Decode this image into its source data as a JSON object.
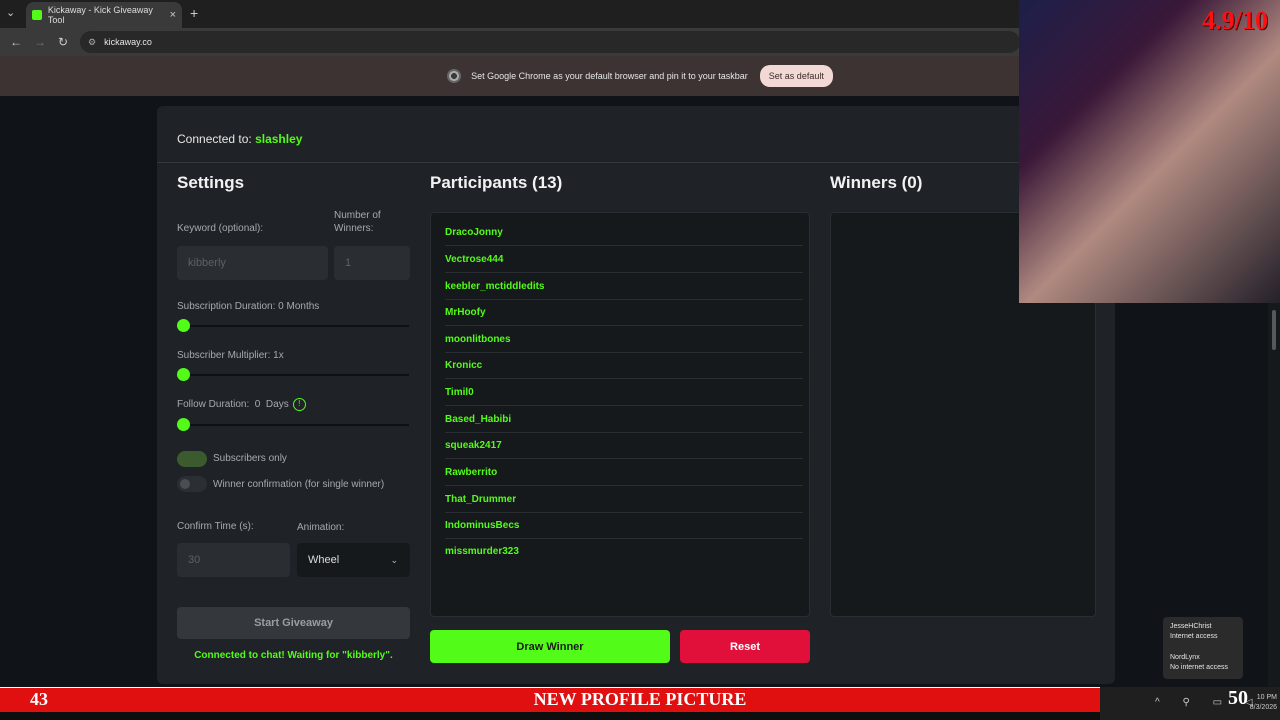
{
  "browser": {
    "tab_list_icon": "chevron-down-icon",
    "tab_title": "Kickaway - Kick Giveaway Tool",
    "tab_close": "×",
    "new_tab": "+",
    "url": "kickaway.co",
    "back": "←",
    "forward": "→",
    "reload": "↻",
    "infobar_text": "Set Google Chrome as your default browser and pin it to your taskbar",
    "set_default_label": "Set as default"
  },
  "app": {
    "connected_prefix": "Connected to:",
    "channel": "slashley",
    "settings": {
      "title": "Settings",
      "keyword_label": "Keyword (optional):",
      "keyword_value": "kibberly",
      "winners_count_label": "Number of Winners:",
      "winners_count_value": "1",
      "sub_duration_label": "Subscription Duration: 0 Months",
      "sub_duration_value": 0,
      "sub_multiplier_label": "Subscriber Multiplier: 1x",
      "sub_multiplier_value": 1,
      "follow_duration_label": "Follow Duration:  0  Days",
      "follow_duration_value": 0,
      "info_glyph": "!",
      "subscribers_only_label": "Subscribers only",
      "subscribers_only_on": true,
      "winner_confirm_label": "Winner confirmation (for single winner)",
      "winner_confirm_on": false,
      "confirm_time_label": "Confirm Time (s):",
      "confirm_time_value": "30",
      "animation_label": "Animation:",
      "animation_value": "Wheel",
      "start_label": "Start Giveaway",
      "status_text": "Connected to chat! Waiting for \"kibberly\"."
    },
    "participants": {
      "title": "Participants (13)",
      "items": [
        "DracoJonny",
        "Vectrose444",
        "keebler_mctiddledits",
        "MrHoofy",
        "moonlitbones",
        "Kronicc",
        "Timil0",
        "Based_Habibi",
        "squeak2417",
        "Rawberrito",
        "That_Drummer",
        "IndominusBecs",
        "missmurder323"
      ]
    },
    "winners": {
      "title": "Winners (0)"
    },
    "draw_label": "Draw Winner",
    "reset_label": "Reset"
  },
  "overlay": {
    "rating": "4.9/10",
    "banner_number": "43",
    "banner_title": "NEW PROFILE PICTURE",
    "right_number": "50"
  },
  "network_popup": {
    "net1_name": "JesseHChrist",
    "net1_status": "Internet access",
    "net2_name": "NordLynx",
    "net2_status": "No internet access"
  },
  "taskbar": {
    "time": "10 PM",
    "date": "8/3/2026"
  },
  "colors": {
    "accent": "#53fc18",
    "danger": "#e0103a",
    "banner": "#e11010"
  }
}
